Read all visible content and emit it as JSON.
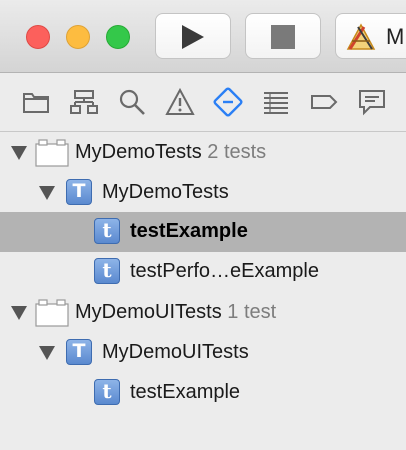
{
  "toolbar": {
    "scheme_label": "M"
  },
  "navigator": {
    "tabs": [
      {
        "icon": "folder-icon"
      },
      {
        "icon": "hierarchy-icon"
      },
      {
        "icon": "search-icon"
      },
      {
        "icon": "warning-icon"
      },
      {
        "icon": "test-navigator-icon",
        "selected": true
      },
      {
        "icon": "debug-icon"
      },
      {
        "icon": "breakpoint-icon"
      },
      {
        "icon": "report-icon"
      }
    ]
  },
  "tree": {
    "groups": [
      {
        "name": "MyDemoTests",
        "count": "2 tests",
        "class_name": "MyDemoTests",
        "methods": [
          "testExample",
          "testPerfo…eExample"
        ]
      },
      {
        "name": "MyDemoUITests",
        "count": "1 test",
        "class_name": "MyDemoUITests",
        "methods": [
          "testExample"
        ]
      }
    ]
  },
  "colors": {
    "accent": "#2a7ff5",
    "selection": "#b3b3b3",
    "class_icon": "#5a89cf",
    "traffic_close": "#fc605c",
    "traffic_min": "#fdbc40",
    "traffic_max": "#34c84a"
  }
}
